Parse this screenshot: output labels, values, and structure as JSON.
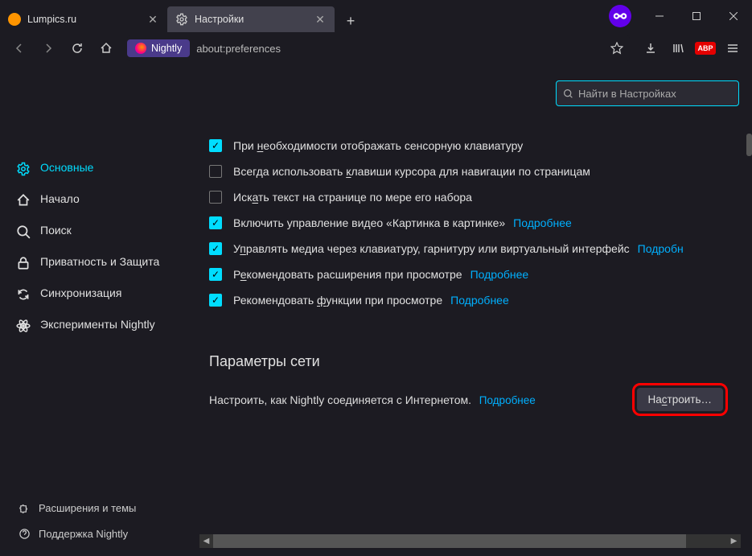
{
  "tabs": [
    {
      "label": "Lumpics.ru",
      "active": false,
      "favicon": "orange"
    },
    {
      "label": "Настройки",
      "active": true,
      "favicon": "gear"
    }
  ],
  "url": {
    "badge": "Nightly",
    "text": "about:preferences"
  },
  "search": {
    "placeholder": "Найти в Настройках"
  },
  "sidebar": {
    "items": [
      {
        "id": "general",
        "label": "Основные",
        "icon": "gear",
        "active": true
      },
      {
        "id": "home",
        "label": "Начало",
        "icon": "home",
        "active": false
      },
      {
        "id": "search",
        "label": "Поиск",
        "icon": "search",
        "active": false
      },
      {
        "id": "privacy",
        "label": "Приватность и Защита",
        "icon": "lock",
        "active": false
      },
      {
        "id": "sync",
        "label": "Синхронизация",
        "icon": "sync",
        "active": false
      },
      {
        "id": "experiments",
        "label": "Эксперименты Nightly",
        "icon": "atom",
        "active": false
      }
    ],
    "bottom": [
      {
        "id": "extensions",
        "label": "Расширения и темы",
        "icon": "puzzle"
      },
      {
        "id": "support",
        "label": "Поддержка Nightly",
        "icon": "help"
      }
    ]
  },
  "checks": [
    {
      "checked": true,
      "pre": "При ",
      "u": "н",
      "post": "еобходимости отображать сенсорную клавиатуру",
      "link": null
    },
    {
      "checked": false,
      "pre": "Всегда использовать ",
      "u": "к",
      "post": "лавиши курсора для навигации по страницам",
      "link": null
    },
    {
      "checked": false,
      "pre": "Иск",
      "u": "а",
      "post": "ть текст на странице по мере его набора",
      "link": null
    },
    {
      "checked": true,
      "pre": "Включить управление видео «Картинка в картинке»",
      "u": "",
      "post": "",
      "link": "Подробнее"
    },
    {
      "checked": true,
      "pre": "У",
      "u": "п",
      "post": "равлять медиа через клавиатуру, гарнитуру или виртуальный интерфейс",
      "link": "Подробн"
    },
    {
      "checked": true,
      "pre": "Р",
      "u": "е",
      "post": "комендовать расширения при просмотре",
      "link": "Подробнее"
    },
    {
      "checked": true,
      "pre": "Рекомендовать ",
      "u": "ф",
      "post": "ункции при просмотре",
      "link": "Подробнее"
    }
  ],
  "network": {
    "title": "Параметры сети",
    "desc_pre": "Настроить, как Nightly соединяется с Интернетом.",
    "desc_link": "Подробнее",
    "button_pre": "На",
    "button_u": "с",
    "button_post": "троить…"
  }
}
